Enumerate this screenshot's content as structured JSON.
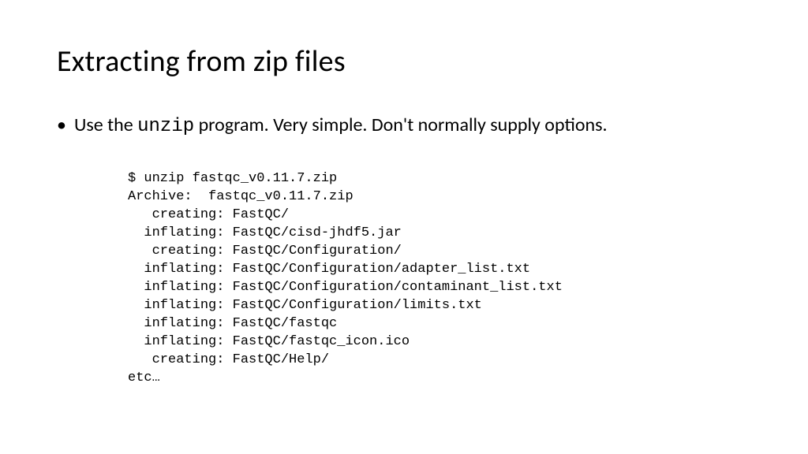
{
  "title": "Extracting from zip files",
  "bullet": {
    "pre": "Use the ",
    "cmd": "unzip",
    "post": " program.  Very simple. Don't normally supply options."
  },
  "code": "$ unzip fastqc_v0.11.7.zip\nArchive:  fastqc_v0.11.7.zip\n   creating: FastQC/\n  inflating: FastQC/cisd-jhdf5.jar\n   creating: FastQC/Configuration/\n  inflating: FastQC/Configuration/adapter_list.txt\n  inflating: FastQC/Configuration/contaminant_list.txt\n  inflating: FastQC/Configuration/limits.txt\n  inflating: FastQC/fastqc\n  inflating: FastQC/fastqc_icon.ico\n   creating: FastQC/Help/\netc…"
}
